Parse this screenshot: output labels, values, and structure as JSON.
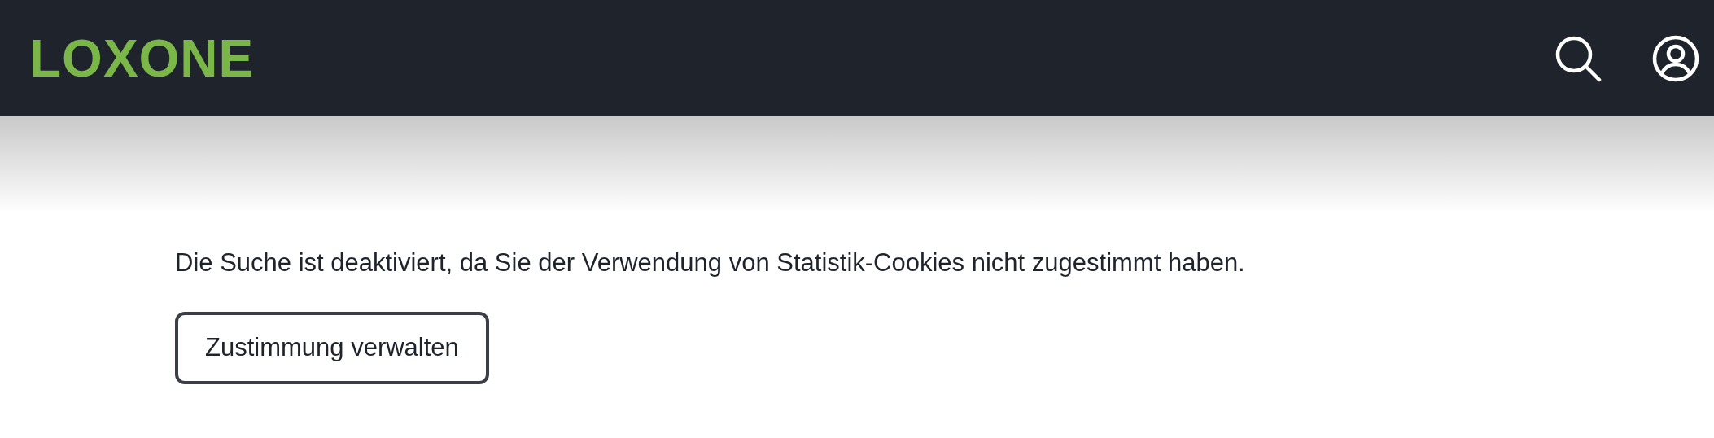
{
  "header": {
    "logo": "LOXONE"
  },
  "notice": {
    "message": "Die Suche ist deaktiviert, da Sie der Verwendung von Statistik-Cookies nicht zugestimmt haben.",
    "button": "Zustimmung verwalten"
  }
}
